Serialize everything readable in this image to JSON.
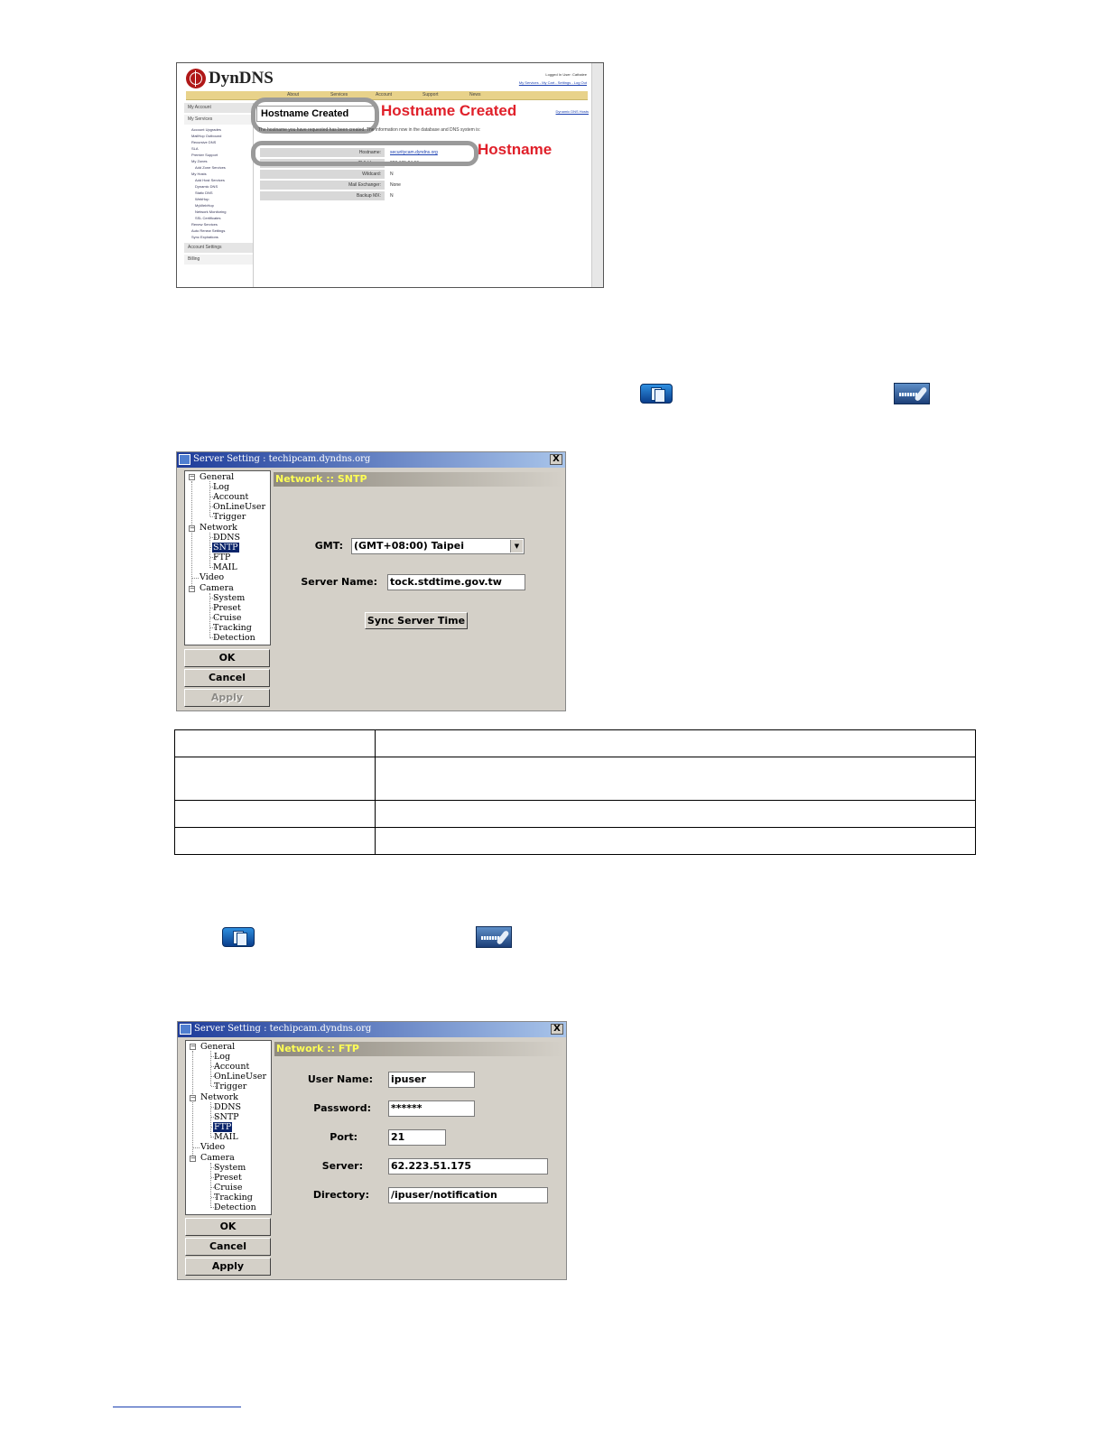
{
  "dyndns": {
    "logo": "DynDNS",
    "user_info": "Logged In User: Cathalee",
    "user_links": "My Services - My Cart - Settings - Log Out",
    "nav": [
      "About",
      "Services",
      "Account",
      "Support",
      "News"
    ],
    "sidebar": {
      "my_account": "My Account",
      "my_services": "My Services",
      "items": [
        "Account Upgrades",
        "MailHop Outbound",
        "Recursive DNS",
        "SLA",
        "Premier Support",
        "My Zones",
        "Add Zone Services",
        "My Hosts",
        "Add Host Services",
        "Dynamic DNS",
        "Static DNS",
        "WebHop",
        "MyWebHop",
        "Network Monitoring",
        "SSL Certificates",
        "Renew Services",
        "Auto Renew Settings",
        "Sync Expirations"
      ],
      "account_settings": "Account Settings",
      "billing": "Billing"
    },
    "page_title": "Hostname Created",
    "annotation_created": "Hostname Created",
    "annotation_hostname": "Hostname",
    "right_link": "Dynamic DNS Hosts",
    "description": "The hostname you have requested has been created. The information now in the database and DNS system is:",
    "table": [
      {
        "key": "Hostname:",
        "value": "securitycam.dyndns.org"
      },
      {
        "key": "IP Address:",
        "value": "220.135.24.66"
      },
      {
        "key": "Wildcard:",
        "value": "N"
      },
      {
        "key": "Mail Exchanger:",
        "value": "None"
      },
      {
        "key": "Backup MX:",
        "value": "N"
      }
    ]
  },
  "sntp_dialog": {
    "title": "Server Setting :   techipcam.dyndns.org",
    "close": "X",
    "tree": {
      "general": "General",
      "log": "Log",
      "account": "Account",
      "online_user": "OnLineUser",
      "trigger": "Trigger",
      "network": "Network",
      "ddns": "DDNS",
      "sntp": "SNTP",
      "ftp": "FTP",
      "mail": "MAIL",
      "video": "Video",
      "camera": "Camera",
      "system": "System",
      "preset": "Preset",
      "cruise": "Cruise",
      "tracking": "Tracking",
      "detection": "Detection",
      "expand_minus": "−"
    },
    "buttons": {
      "ok": "OK",
      "cancel": "Cancel",
      "apply": "Apply"
    },
    "panel_title": "Network :: SNTP",
    "gmt_label": "GMT:",
    "gmt_value": "(GMT+08:00) Taipei",
    "dropdown_arrow": "▼",
    "server_name_label": "Server Name:",
    "server_name_value": "tock.stdtime.gov.tw",
    "sync_button": "Sync Server Time"
  },
  "ftp_dialog": {
    "title": "Server Setting :   techipcam.dyndns.org",
    "close": "X",
    "tree": {
      "general": "General",
      "log": "Log",
      "account": "Account",
      "online_user": "OnLineUser",
      "trigger": "Trigger",
      "network": "Network",
      "ddns": "DDNS",
      "sntp": "SNTP",
      "ftp": "FTP",
      "mail": "MAIL",
      "video": "Video",
      "camera": "Camera",
      "system": "System",
      "preset": "Preset",
      "cruise": "Cruise",
      "tracking": "Tracking",
      "detection": "Detection",
      "expand_minus": "−"
    },
    "buttons": {
      "ok": "OK",
      "cancel": "Cancel",
      "apply": "Apply"
    },
    "panel_title": "Network :: FTP",
    "fields": {
      "user_name_label": "User Name:",
      "user_name_value": "ipuser",
      "password_label": "Password:",
      "password_value": "******",
      "port_label": "Port:",
      "port_value": "21",
      "server_label": "Server:",
      "server_value": "62.223.51.175",
      "directory_label": "Directory:",
      "directory_value": "/ipuser/notification"
    }
  },
  "icons": {
    "config": "config-icon",
    "network": "network-icon"
  },
  "colors": {
    "annotation_red": "#e0202a",
    "panel_title_yellow": "#ffff55",
    "titlebar_blue": "#1e3c9a",
    "dialog_gray": "#d4d0c8"
  }
}
